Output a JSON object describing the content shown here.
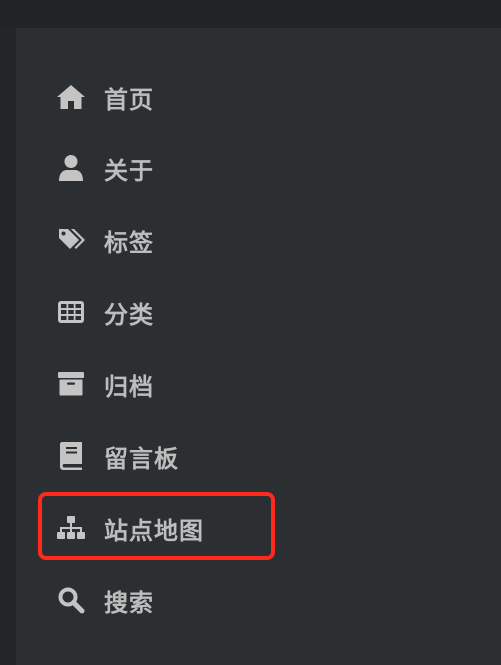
{
  "menu": {
    "items": [
      {
        "label": "首页",
        "icon": "home-icon"
      },
      {
        "label": "关于",
        "icon": "user-icon"
      },
      {
        "label": "标签",
        "icon": "tags-icon"
      },
      {
        "label": "分类",
        "icon": "grid-icon"
      },
      {
        "label": "归档",
        "icon": "archive-icon"
      },
      {
        "label": "留言板",
        "icon": "book-icon"
      },
      {
        "label": "站点地图",
        "icon": "sitemap-icon"
      },
      {
        "label": "搜索",
        "icon": "search-icon"
      }
    ],
    "highlighted_index": 6
  },
  "colors": {
    "panel_background": "#2b2f31",
    "page_background": "#212325",
    "text": "#bdbdbd",
    "icon": "#c4c4c4",
    "highlight_border": "#ff2a1d"
  }
}
